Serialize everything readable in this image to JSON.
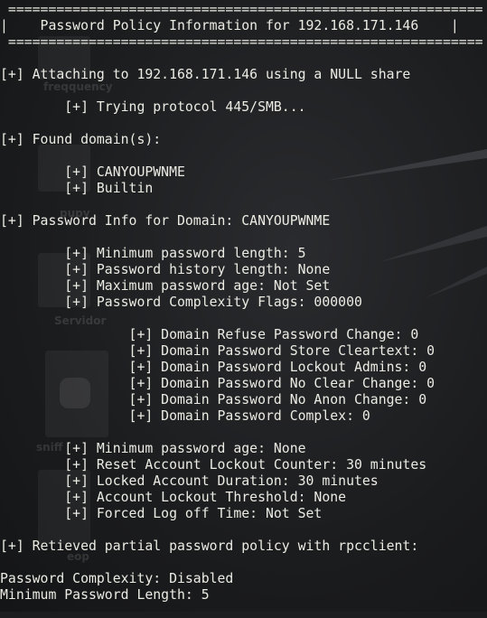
{
  "desktop": {
    "icon_labels": [
      "freqquency",
      "pupy",
      "Servidor",
      "sniff",
      "eop"
    ]
  },
  "terminal": {
    "lines": [
      " =========================================================== ",
      "|    Password Policy Information for 192.168.171.146    |",
      " =========================================================== ",
      "",
      "[+] Attaching to 192.168.171.146 using a NULL share",
      "",
      "        [+] Trying protocol 445/SMB...",
      "",
      "[+] Found domain(s):",
      "",
      "        [+] CANYOUPWNME",
      "        [+] Builtin",
      "",
      "[+] Password Info for Domain: CANYOUPWNME",
      "",
      "        [+] Minimum password length: 5",
      "        [+] Password history length: None",
      "        [+] Maximum password age: Not Set",
      "        [+] Password Complexity Flags: 000000",
      "",
      "                [+] Domain Refuse Password Change: 0",
      "                [+] Domain Password Store Cleartext: 0",
      "                [+] Domain Password Lockout Admins: 0",
      "                [+] Domain Password No Clear Change: 0",
      "                [+] Domain Password No Anon Change: 0",
      "                [+] Domain Password Complex: 0",
      "",
      "        [+] Minimum password age: None",
      "        [+] Reset Account Lockout Counter: 30 minutes",
      "        [+] Locked Account Duration: 30 minutes",
      "        [+] Account Lockout Threshold: None",
      "        [+] Forced Log off Time: Not Set",
      "",
      "[+] Retieved partial password policy with rpcclient:",
      "",
      "Password Complexity: Disabled",
      "Minimum Password Length: 5"
    ]
  }
}
